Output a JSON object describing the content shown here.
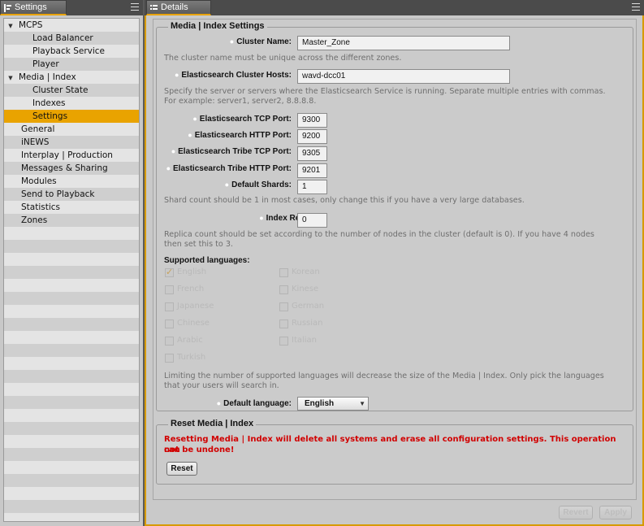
{
  "left_panel": {
    "tab_label": "Settings",
    "tree": [
      {
        "label": "MCPS",
        "level": 0,
        "expanded": true
      },
      {
        "label": "Load Balancer",
        "level": 1
      },
      {
        "label": "Playback Service",
        "level": 1
      },
      {
        "label": "Player",
        "level": 1
      },
      {
        "label": "Media | Index",
        "level": 0,
        "expanded": true
      },
      {
        "label": "Cluster State",
        "level": 1
      },
      {
        "label": "Indexes",
        "level": 1
      },
      {
        "label": "Settings",
        "level": 1,
        "selected": true
      },
      {
        "label": "General",
        "level": 0
      },
      {
        "label": "iNEWS",
        "level": 0
      },
      {
        "label": "Interplay | Production",
        "level": 0
      },
      {
        "label": "Messages & Sharing",
        "level": 0
      },
      {
        "label": "Modules",
        "level": 0
      },
      {
        "label": "Send to Playback",
        "level": 0
      },
      {
        "label": "Statistics",
        "level": 0
      },
      {
        "label": "Zones",
        "level": 0
      }
    ]
  },
  "right_panel": {
    "tab_label": "Details",
    "media_index_settings": {
      "legend": "Media | Index Settings",
      "cluster_name": {
        "label": "Cluster Name:",
        "value": "Master_Zone"
      },
      "cluster_name_help": "The cluster name must be unique across the different zones.",
      "cluster_hosts": {
        "label": "Elasticsearch Cluster Hosts:",
        "value": "wavd-dcc01"
      },
      "cluster_hosts_help_1": "Specify the server or servers where the Elasticsearch Service is running. Separate multiple entries with commas.",
      "cluster_hosts_help_2": "For example: server1, server2, 8.8.8.8.",
      "tcp_port": {
        "label": "Elasticsearch TCP Port:",
        "value": "9300"
      },
      "http_port": {
        "label": "Elasticsearch HTTP Port:",
        "value": "9200"
      },
      "tribe_tcp_port": {
        "label": "Elasticsearch Tribe TCP Port:",
        "value": "9305"
      },
      "tribe_http_port": {
        "label": "Elasticsearch Tribe HTTP Port:",
        "value": "9201"
      },
      "default_shards": {
        "label": "Default Shards:",
        "value": "1"
      },
      "shards_help": "Shard count should be 1 in most cases, only change this if you have a very large databases.",
      "index_replicas": {
        "label": "Index Replicas:",
        "value": "0"
      },
      "replicas_help_1": "Replica count should be set according to the number of nodes in the cluster (default is 0). If you have 4 nodes",
      "replicas_help_2": "then set this to 3.",
      "supported_languages_label": "Supported languages:",
      "languages": [
        {
          "label": "English",
          "checked": true
        },
        {
          "label": "Korean",
          "checked": false
        },
        {
          "label": "French",
          "checked": false
        },
        {
          "label": "Kinese",
          "checked": false
        },
        {
          "label": "Japanese",
          "checked": false
        },
        {
          "label": "German",
          "checked": false
        },
        {
          "label": "Chinese",
          "checked": false
        },
        {
          "label": "Russian",
          "checked": false
        },
        {
          "label": "Arabic",
          "checked": false
        },
        {
          "label": "Italian",
          "checked": false
        },
        {
          "label": "Turkish",
          "checked": false
        }
      ],
      "languages_help_1": "Limiting the number of supported languages will decrease the size of the Media | Index. Only pick the languages",
      "languages_help_2": "that your users will search in.",
      "default_language": {
        "label": "Default language:",
        "value": "English"
      }
    },
    "reset_group": {
      "legend": "Reset Media | Index",
      "warning_1": "Resetting Media | Index will delete all systems and erase all configuration settings. This operation can",
      "warning_2": "not be undone!",
      "reset_label": "Reset"
    },
    "footer": {
      "revert_label": "Revert",
      "apply_label": "Apply"
    }
  },
  "colors": {
    "accent": "#e9a300",
    "warning": "#d10000"
  }
}
